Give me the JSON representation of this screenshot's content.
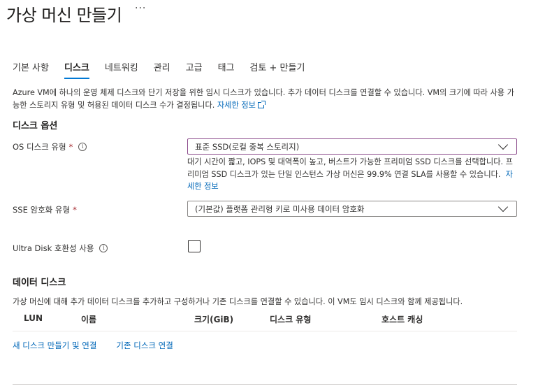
{
  "page": {
    "title": "가상 머신 만들기",
    "more": "···"
  },
  "tabs": [
    {
      "label": "기본 사항"
    },
    {
      "label": "디스크"
    },
    {
      "label": "네트워킹"
    },
    {
      "label": "관리"
    },
    {
      "label": "고급"
    },
    {
      "label": "태그"
    },
    {
      "label": "검토 + 만들기"
    }
  ],
  "active_tab": "디스크",
  "intro": {
    "text": "Azure VM에 하나의 운영 체제 디스크와 단기 저장을 위한 임시 디스크가 있습니다. 추가 데이터 디스크를 연결할 수 있습니다. VM의 크기에 따라 사용 가능한 스토리지 유형 및 허용된 데이터 디스크 수가 결정됩니다.",
    "link": "자세한 정보"
  },
  "disk_options": {
    "heading": "디스크 옵션",
    "os_disk_type": {
      "label": "OS 디스크 유형",
      "required": "*",
      "value": "표준 SSD(로컬 중복 스토리지)",
      "helper": "대기 시간이 짧고, IOPS 및 대역폭이 높고, 버스트가 가능한 프리미엄 SSD 디스크를 선택합니다. 프리미엄 SSD 디스크가 있는 단일 인스턴스 가상 머신은 99.9% 연결 SLA를 사용할 수 있습니다.",
      "helper_link": "자세한 정보"
    },
    "sse_encryption": {
      "label": "SSE 암호화 유형",
      "required": "*",
      "value": "(기본값) 플랫폼 관리형 키로 미사용 데이터 암호화"
    },
    "ultra_disk": {
      "label": "Ultra Disk 호환성 사용",
      "checked": false
    }
  },
  "data_disks": {
    "heading": "데이터 디스크",
    "description": "가상 머신에 대해 추가 데이터 디스크를 추가하고 구성하거나 기존 디스크를 연결할 수 있습니다. 이 VM도 임시 디스크와 함께 제공됩니다.",
    "columns": [
      "LUN",
      "이름",
      "크기(GiB)",
      "디스크 유형",
      "호스트 캐싱"
    ],
    "actions": {
      "create_attach": "새 디스크 만들기 및 연결",
      "attach_existing": "기존 디스크 연결"
    }
  },
  "colors": {
    "accent": "#0078d4",
    "link": "#0067b8",
    "required": "#a4262c",
    "focus_border": "#8b4a8b"
  }
}
